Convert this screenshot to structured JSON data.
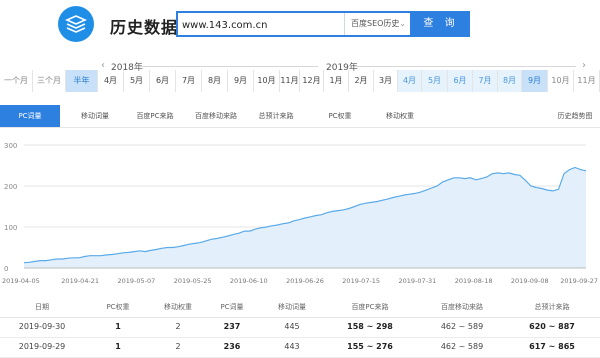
{
  "header": {
    "title": "历史数据",
    "search_value": "www.143.com.cn",
    "select_value": "百度SEO历史",
    "search_button": "查 询"
  },
  "years": {
    "y2018": "2018年",
    "y2019": "2019年"
  },
  "months": [
    {
      "label": "一个月",
      "state": "grey"
    },
    {
      "label": "三个月",
      "state": "grey"
    },
    {
      "label": "半年",
      "state": "sel"
    },
    {
      "label": "4月",
      "state": ""
    },
    {
      "label": "5月",
      "state": ""
    },
    {
      "label": "6月",
      "state": ""
    },
    {
      "label": "7月",
      "state": ""
    },
    {
      "label": "8月",
      "state": ""
    },
    {
      "label": "9月",
      "state": ""
    },
    {
      "label": "10月",
      "state": ""
    },
    {
      "label": "11月",
      "state": ""
    },
    {
      "label": "12月",
      "state": ""
    },
    {
      "label": "1月",
      "state": ""
    },
    {
      "label": "2月",
      "state": ""
    },
    {
      "label": "3月",
      "state": ""
    },
    {
      "label": "4月",
      "state": "range"
    },
    {
      "label": "5月",
      "state": "range"
    },
    {
      "label": "6月",
      "state": "range"
    },
    {
      "label": "7月",
      "state": "range"
    },
    {
      "label": "8月",
      "state": "range"
    },
    {
      "label": "9月",
      "state": "sel"
    },
    {
      "label": "10月",
      "state": "grey"
    },
    {
      "label": "11月",
      "state": "grey"
    }
  ],
  "tabs": [
    "PC词量",
    "移动词量",
    "百度PC来路",
    "百度移动来路",
    "总预计来路",
    "PC权重",
    "移动权重"
  ],
  "tab_right": "历史趋势图",
  "colors": {
    "accent": "#2d7fe0",
    "line": "#5aaae8",
    "fill": "#e3f0fb"
  },
  "chart_data": {
    "type": "area",
    "y_ticks": [
      "300",
      "200",
      "100",
      "0"
    ],
    "x_ticks": [
      "2019-04-05",
      "2019-04-21",
      "2019-05-07",
      "2019-05-25",
      "2019-06-10",
      "2019-06-26",
      "2019-07-15",
      "2019-07-31",
      "2019-08-18",
      "2019-09-08",
      "2019-09-27"
    ],
    "ylim": [
      0,
      300
    ],
    "values": [
      13,
      14,
      16,
      18,
      18,
      20,
      22,
      22,
      24,
      25,
      25,
      28,
      30,
      30,
      30,
      32,
      33,
      35,
      37,
      38,
      40,
      42,
      40,
      43,
      45,
      48,
      50,
      50,
      52,
      55,
      58,
      60,
      62,
      66,
      70,
      72,
      75,
      78,
      82,
      85,
      90,
      90,
      95,
      98,
      100,
      103,
      105,
      108,
      110,
      115,
      118,
      122,
      125,
      128,
      130,
      135,
      138,
      140,
      142,
      145,
      150,
      155,
      158,
      160,
      162,
      165,
      168,
      172,
      175,
      178,
      180,
      182,
      185,
      190,
      195,
      200,
      210,
      215,
      220,
      220,
      218,
      220,
      215,
      218,
      222,
      230,
      232,
      230,
      232,
      228,
      226,
      214,
      200,
      196,
      194,
      190,
      188,
      192,
      230,
      240,
      245,
      240,
      237
    ]
  },
  "table": {
    "headers": [
      "日期",
      "PC权重",
      "移动权重",
      "PC词量",
      "移动词量",
      "百度PC来路",
      "百度移动来路",
      "总预计来路"
    ],
    "rows": [
      [
        "2019-09-30",
        "1",
        "2",
        "237",
        "445",
        "158 ~ 298",
        "462 ~ 589",
        "620 ~ 887"
      ],
      [
        "2019-09-29",
        "1",
        "2",
        "236",
        "443",
        "155 ~ 276",
        "462 ~ 589",
        "617 ~ 865"
      ]
    ]
  }
}
